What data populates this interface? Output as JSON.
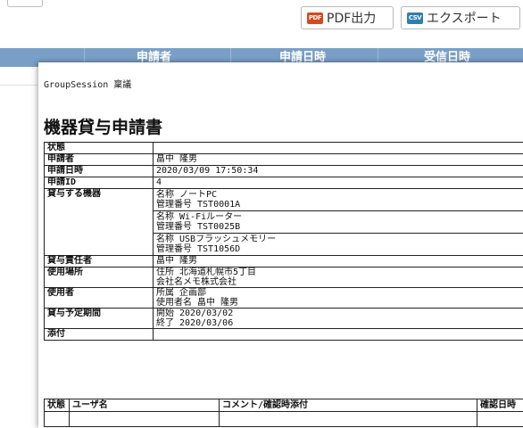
{
  "toolbar": {
    "pdf_icon": "PDF",
    "pdf_label": "PDF出力",
    "csv_icon": "CSV",
    "csv_label": "エクスポート"
  },
  "background_table": {
    "headers": [
      "申請者",
      "申請日時",
      "受信日時"
    ]
  },
  "document": {
    "caption": "GroupSession 稟議",
    "title": "機器貸与申請書",
    "rows": {
      "status_label": "状態",
      "status_value": "",
      "applicant_label": "申請者",
      "applicant_value": "畠中 隆男",
      "date_label": "申請日時",
      "date_value": "2020/03/09 17:50:34",
      "id_label": "申請ID",
      "id_value": "4",
      "devices_label": "貸与する機器",
      "devices": [
        {
          "line1": "名称 ノートPC",
          "line2": "管理番号 TST0001A"
        },
        {
          "line1": "名称 Wi-Fiルーター",
          "line2": "管理番号 TST0025B"
        },
        {
          "line1": "名称 USBフラッシュメモリー",
          "line2": "管理番号 TST1056D"
        }
      ],
      "manager_label": "貸与責任者",
      "manager_value": "畠中 隆男",
      "place_label": "使用場所",
      "place_line1": "住所 北海道札幌市5丁目",
      "place_line2": "会社名メモ株式会社",
      "user_label": "使用者",
      "user_line1": "所属 企画部",
      "user_line2": "使用者名 畠中 隆男",
      "period_label": "貸与予定期間",
      "period_line1": "開始 2020/03/02",
      "period_line2": "終了 2020/03/06",
      "attach_label": "添付",
      "attach_value": ""
    },
    "log_headers": [
      "状態",
      "ユーザ名",
      "コメント/確認時添付",
      "確認日時"
    ]
  }
}
